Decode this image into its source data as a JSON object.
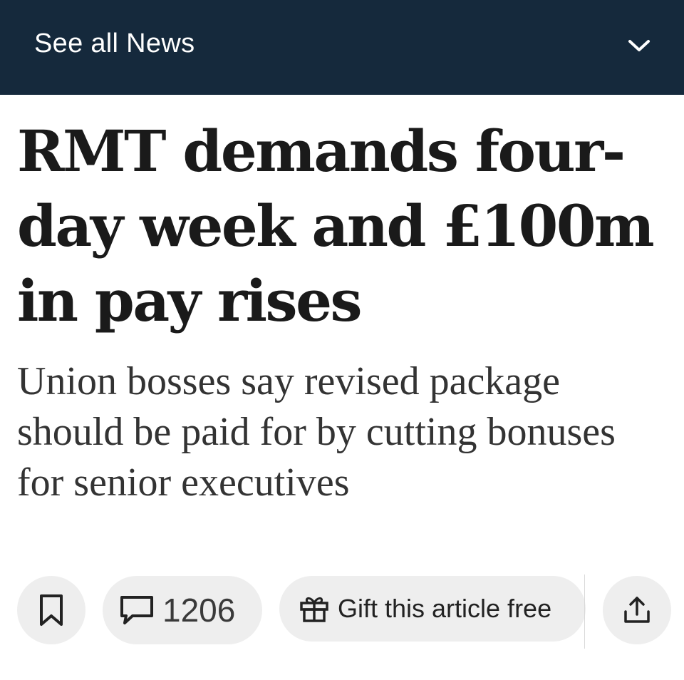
{
  "nav": {
    "section_label": "See all News",
    "expand_icon": "chevron-down-icon"
  },
  "article": {
    "headline": "RMT demands four-day week and £100m in pay rises",
    "standfirst": "Union bosses say revised package should be paid for by cutting bonuses for senior executives"
  },
  "actions": {
    "bookmark_icon": "bookmark-icon",
    "comment_icon": "comment-icon",
    "comment_count": "1206",
    "gift_icon": "gift-icon",
    "gift_label": "Gift this article free",
    "share_icon": "share-icon"
  },
  "colors": {
    "topbar_bg": "#15293c",
    "pill_bg": "#eeeeee",
    "text_dark": "#1a1a1a"
  }
}
